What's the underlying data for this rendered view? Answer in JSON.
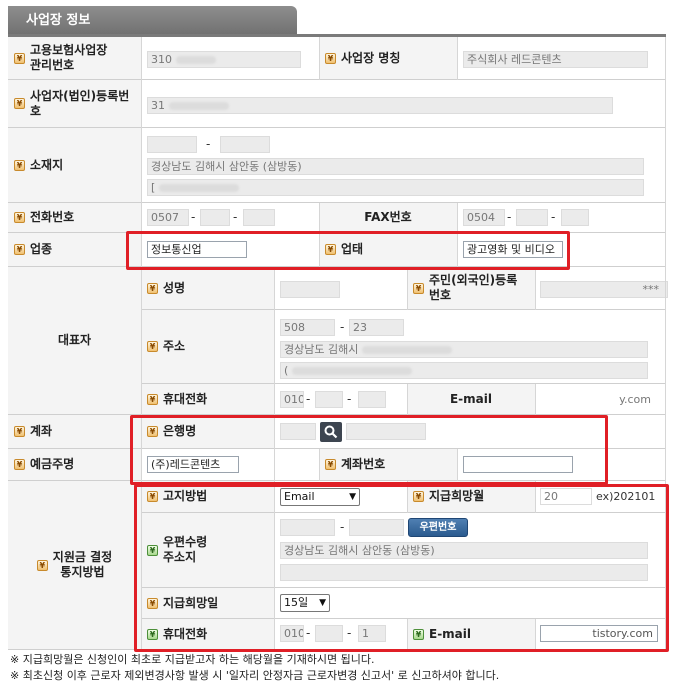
{
  "section_title": "사업장 정보",
  "labels": {
    "insurance_no": "고용보험사업장\n관리번호",
    "biz_name": "사업장 명칭",
    "reg_no": "사업자(법인)등록번\n호",
    "address": "소재지",
    "phone": "전화번호",
    "fax": "FAX번호",
    "industry": "업종",
    "biz_type": "업태",
    "representative": "대표자",
    "rep_name": "성명",
    "rep_id": "주민(외국인)등록\n번호",
    "rep_address": "주소",
    "rep_mobile": "휴대전화",
    "rep_email": "E-mail",
    "account": "계좌",
    "bank": "은행명",
    "depositor": "예금주명",
    "account_no": "계좌번호",
    "notify": "지원금 결정\n통지방법",
    "notice_method": "고지방법",
    "pay_month": "지급희망월",
    "mail_address": "우편수령\n주소지",
    "pay_day": "지급희망일",
    "mobile": "휴대전화",
    "email": "E-mail"
  },
  "values": {
    "insurance_no": "310",
    "biz_name": "주식회사 레드콘텐츠",
    "reg_no": "31",
    "addr_line": "경상남도 김해시 삼안동 (삼방동)",
    "addr_line3": "[",
    "phone_prefix": "0507",
    "fax_prefix": "0504",
    "industry": "정보통신업",
    "biz_type": "광고영화 및 비디오",
    "rep_id_suffix": "***",
    "rep_zip1": "508",
    "rep_zip2": "23",
    "rep_addr": "경상남도 김해시",
    "rep_addr_line2": "(",
    "rep_mobile_prefix": "010",
    "rep_email_suffix": "y.com",
    "depositor": "(주)레드콘텐츠",
    "notice_method": "Email",
    "pay_month_prefix": "20",
    "pay_month_hint": "ex)202101",
    "zip_button": "우편번호",
    "mail_addr": "경상남도 김해시 삼안동 (삼방동)",
    "pay_day": "15일",
    "mobile_prefix": "010",
    "mobile_last": "1",
    "email_suffix": "tistory.com"
  },
  "notes": [
    "※ 지급희망월은 신청인이 최초로 지급받고자 하는 해당월을 기재하시면 됩니다.",
    "※ 최초신청 이후 근로자 제외변경사항 발생 시 '일자리 안정자금 근로자변경 신고서' 로 신고하셔야 합니다."
  ],
  "colors": {
    "highlight": "#e01f26",
    "label_bg": "#f4f4f4",
    "header_bg": "#7a7a7a"
  }
}
